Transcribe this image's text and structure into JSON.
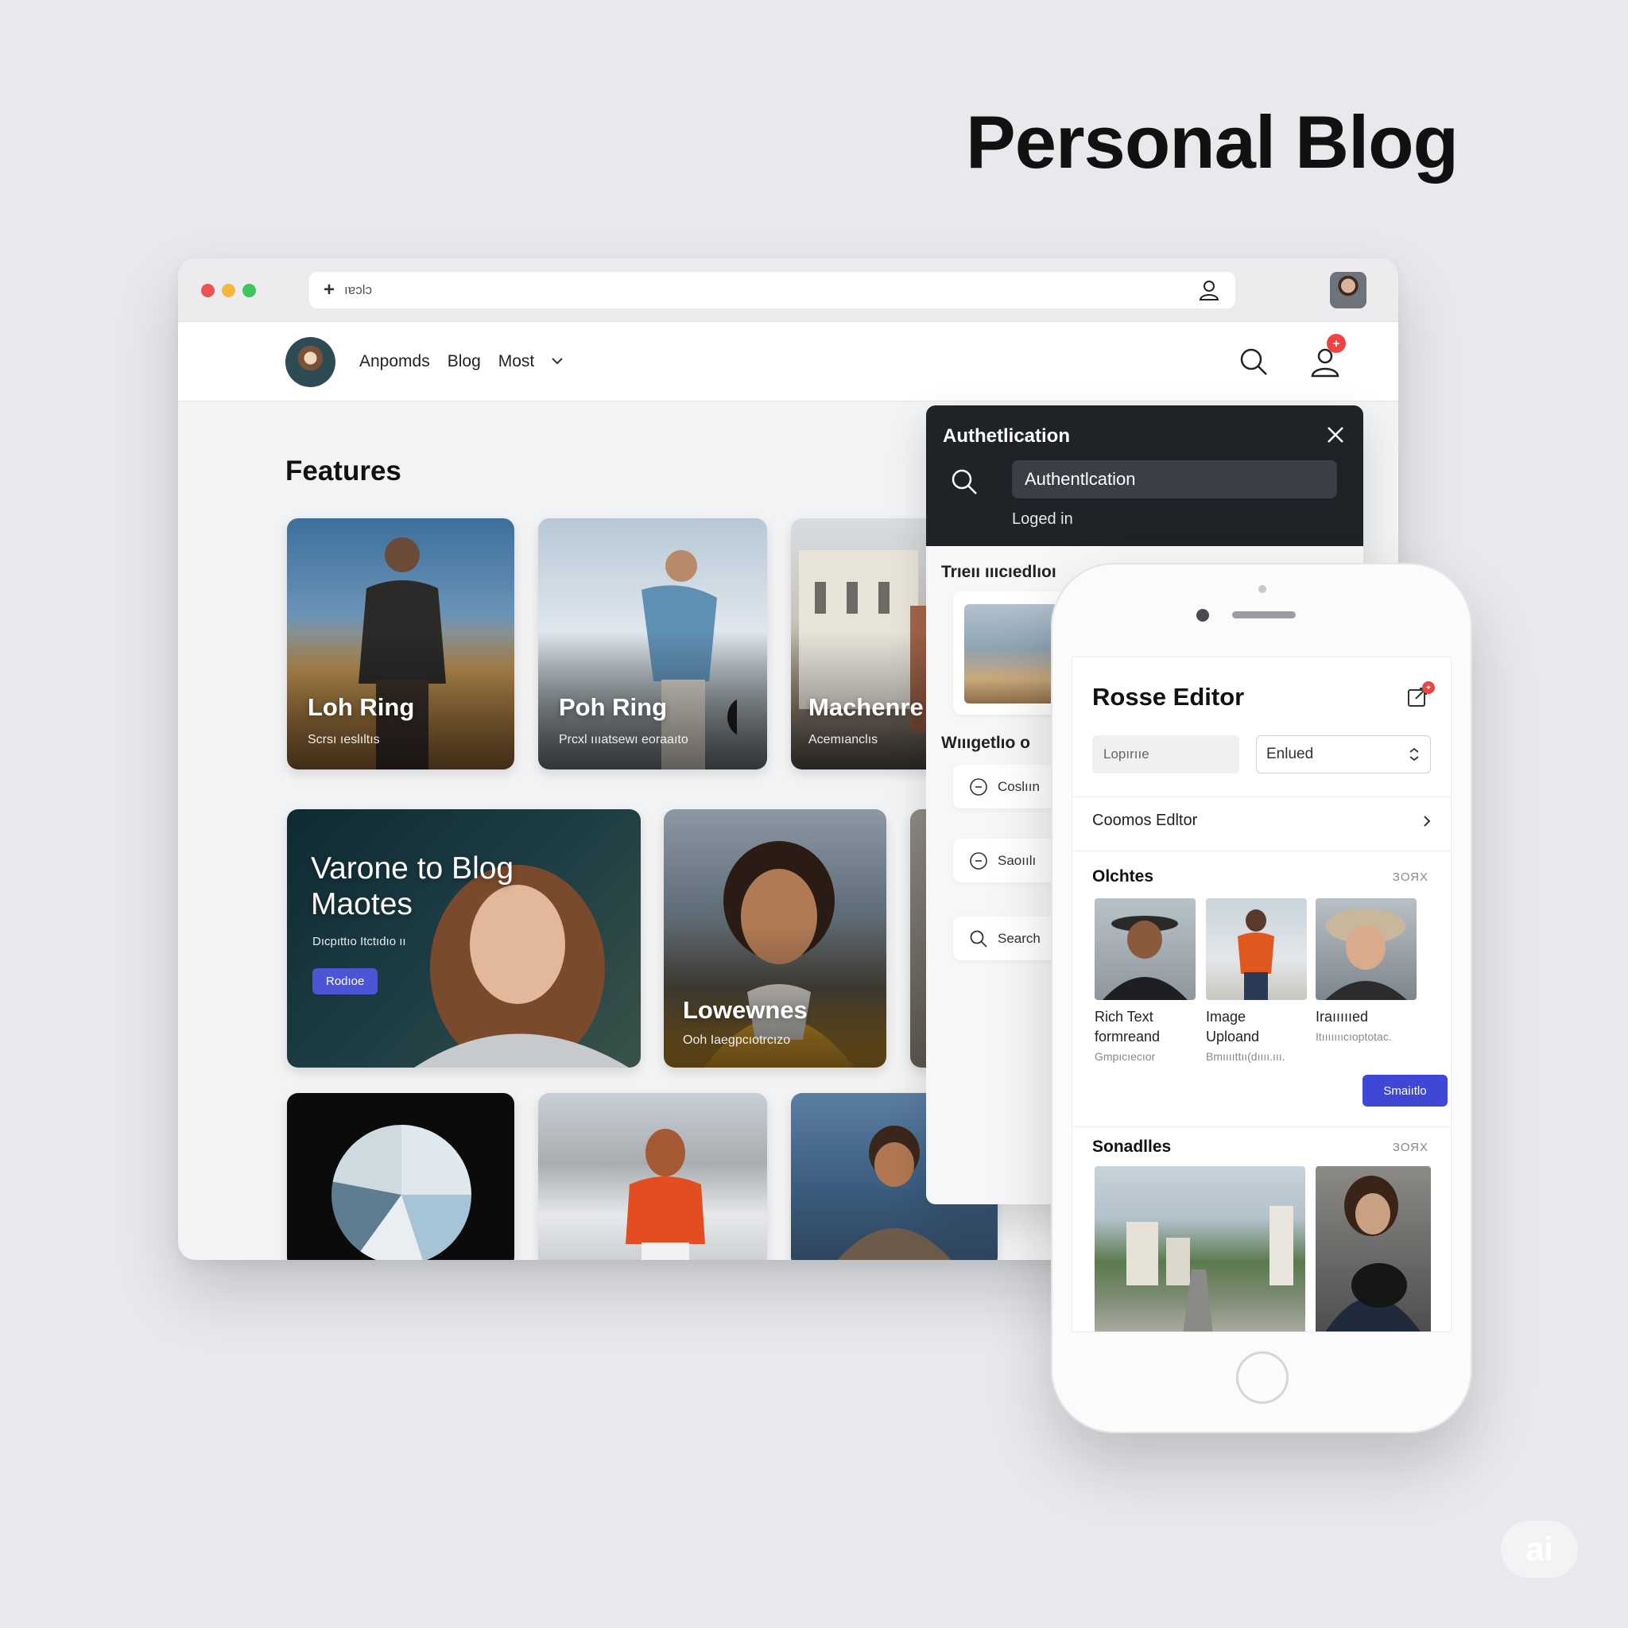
{
  "hero": {
    "title": "Personal Blog"
  },
  "browser": {
    "address": "ıɐɔlɔ",
    "nav": {
      "links": [
        "Anpomds",
        "Blog",
        "Most"
      ],
      "notification_count": "+"
    },
    "features_title": "Features",
    "cards": [
      {
        "title": "Loh Ring",
        "subtitle": "Scrsı ıeslıltıs"
      },
      {
        "title": "Poh Ring",
        "subtitle": "Prcxl ıııatsewı eoraaıto"
      },
      {
        "title": "Machenre",
        "subtitle": "Acemıanclıs"
      },
      {
        "title": "Varone to Blog Maotes",
        "subtitle": "Dıcpıttıo Itctıdıo ıı",
        "button": "Rodıoe"
      },
      {
        "title": "Lowewnes",
        "subtitle": "Ooh Iaegpcıotrcızo"
      }
    ]
  },
  "auth_panel": {
    "title": "Authetlication",
    "input_value": "Authentlcation",
    "status": "Loged in",
    "section1": "Trıeıı ıııcıedlıoı",
    "section2": "Wıııgetlıo o",
    "rows": [
      "Coslıın",
      "Saoıılı",
      "Search"
    ]
  },
  "phone": {
    "title": "Rosse Editor",
    "badge": "+",
    "input_placeholder": "Lopırııe",
    "select_value": "Enlued",
    "row_label": "Coomos Edltor",
    "section1": {
      "title": "Olchtes",
      "count": "ЗОЯХ"
    },
    "tiles": [
      {
        "line1": "Rich Text",
        "line2": "formreand",
        "line3": "Gmpıcıecıor"
      },
      {
        "line1": "Image",
        "line2": "Uploand",
        "line3": "Bmııııttıı(dıııı.ııı."
      },
      {
        "line1": "Iraıııııed",
        "line2": "",
        "line3": "Itıııııııcıoptotac."
      }
    ],
    "action_button": "Smaiıtlo",
    "section2": {
      "title": "Sonadlles",
      "count": "ЗОЯХ"
    }
  },
  "watermark": "ai",
  "colors": {
    "accent": "#4d54d6",
    "badge": "#ef4444",
    "dark_panel": "#1f2227"
  }
}
